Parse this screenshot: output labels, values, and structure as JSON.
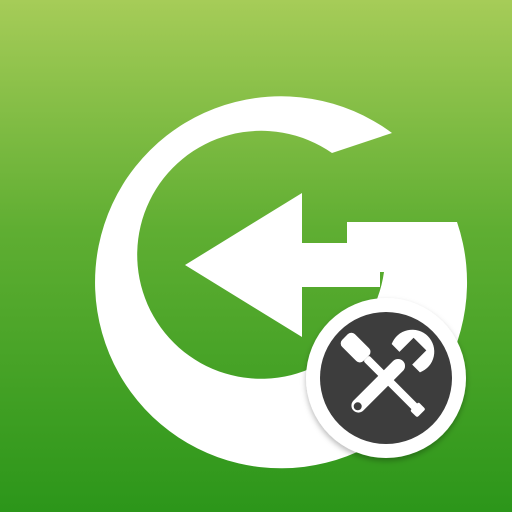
{
  "icon": {
    "name": "app-icon",
    "glyph": "g-arrow-logo",
    "badge_glyph": "screwdriver-wrench-icon"
  },
  "colors": {
    "background_top": "#a6cc58",
    "background_mid": "#5fae32",
    "background_bottom": "#2c961a",
    "logo": "#ffffff",
    "badge_fill": "#3d3d3d",
    "badge_ring": "#ffffff",
    "tools": "#ffffff"
  }
}
